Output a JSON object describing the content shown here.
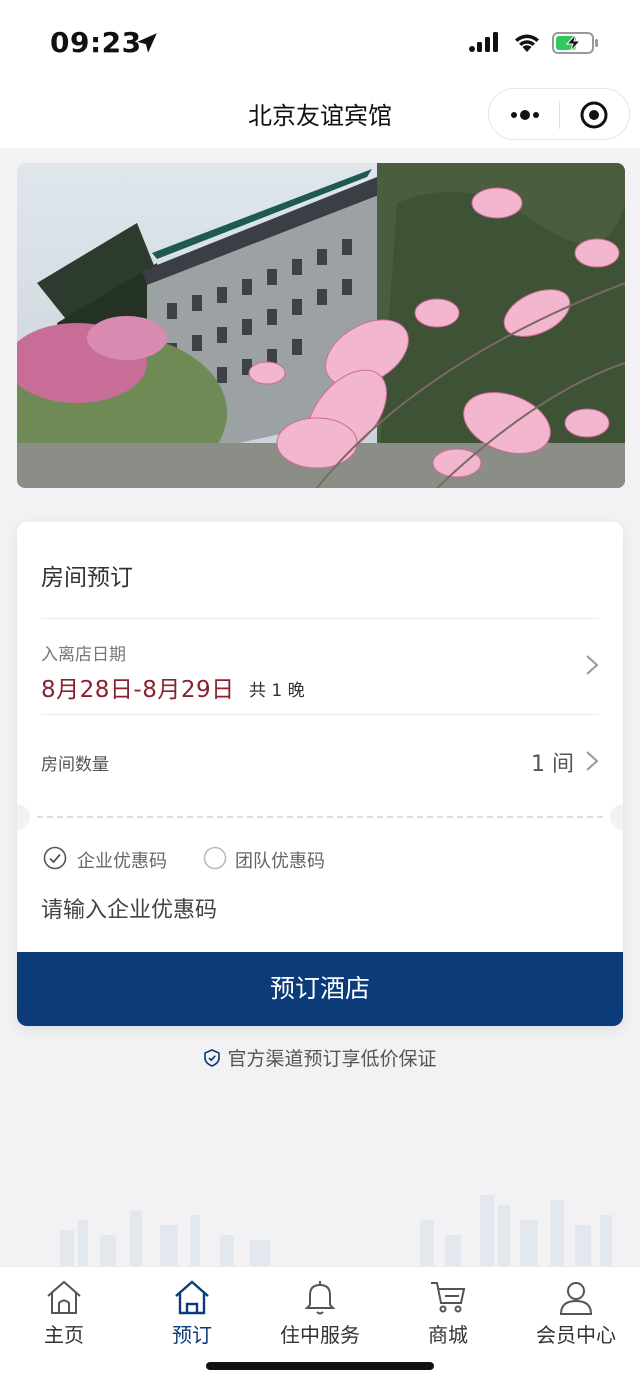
{
  "status_bar": {
    "time": "09:23",
    "icons": [
      "location-arrow-icon",
      "cellular-signal-icon",
      "wifi-icon",
      "battery-charging-icon"
    ]
  },
  "nav": {
    "title": "北京友谊宾馆",
    "icons": [
      "more-dots-icon",
      "close-target-icon"
    ]
  },
  "hero": {
    "description_icon": "hotel-photo"
  },
  "booking": {
    "title": "房间预订",
    "date_label": "入离店日期",
    "date_range": "8月28日-8月29日",
    "nights": "共 1 晚",
    "rooms_label": "房间数量",
    "rooms_value": "1 间",
    "promo_options": [
      {
        "label": "企业优惠码",
        "selected": true
      },
      {
        "label": "团队优惠码",
        "selected": false
      }
    ],
    "promo_placeholder": "请输入企业优惠码",
    "book_button": "预订酒店"
  },
  "guarantee_text": "官方渠道预订享低价保证",
  "tabs": [
    {
      "label": "主页",
      "icon": "home-icon",
      "active": false
    },
    {
      "label": "预订",
      "icon": "home-icon",
      "active": true
    },
    {
      "label": "住中服务",
      "icon": "bell-icon",
      "active": false
    },
    {
      "label": "商城",
      "icon": "cart-icon",
      "active": false
    },
    {
      "label": "会员中心",
      "icon": "user-icon",
      "active": false
    }
  ],
  "colors": {
    "primary": "#0b3b78",
    "date_accent": "#8a2131",
    "background": "#f2f2f4"
  }
}
